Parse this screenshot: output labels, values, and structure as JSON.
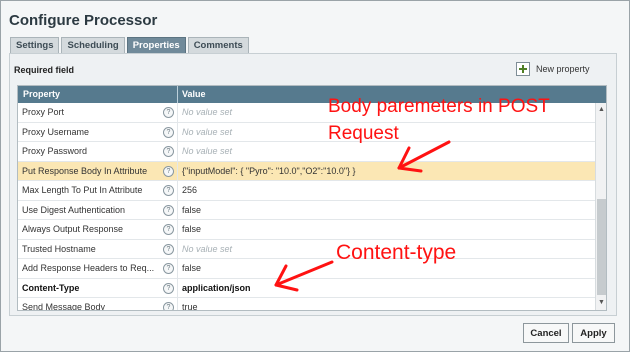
{
  "dialog": {
    "title": "Configure Processor",
    "tabs": [
      "Settings",
      "Scheduling",
      "Properties",
      "Comments"
    ],
    "active_tab": "Properties"
  },
  "panel": {
    "required_field": "Required field",
    "new_property": "New property"
  },
  "table": {
    "headers": [
      "Property",
      "Value"
    ],
    "rows": [
      {
        "property": "Proxy Port",
        "value": "No value set",
        "empty": true
      },
      {
        "property": "Proxy Username",
        "value": "No value set",
        "empty": true
      },
      {
        "property": "Proxy Password",
        "value": "No value set",
        "empty": true
      },
      {
        "property": "Put Response Body In Attribute",
        "value": "{\"inputModel\": { \"Pyro\": \"10.0\",\"O2\":\"10.0\"} }",
        "highlight": true
      },
      {
        "property": "Max Length To Put In Attribute",
        "value": "256"
      },
      {
        "property": "Use Digest Authentication",
        "value": "false"
      },
      {
        "property": "Always Output Response",
        "value": "false"
      },
      {
        "property": "Trusted Hostname",
        "value": "No value set",
        "empty": true
      },
      {
        "property": "Add Response Headers to Req...",
        "value": "false"
      },
      {
        "property": "Content-Type",
        "value": "application/json",
        "bold": true
      },
      {
        "property": "Send Message Body",
        "value": "true"
      }
    ]
  },
  "buttons": {
    "cancel": "Cancel",
    "apply": "Apply"
  },
  "annotations": {
    "body_line1": "Body paremeters in POST",
    "body_line2": "Request",
    "content_type": "Content-type",
    "color": "#ff1212"
  },
  "icons": [
    "plus-icon",
    "help-icon",
    "scroll-up-arrow-icon",
    "scroll-down-arrow-icon"
  ]
}
